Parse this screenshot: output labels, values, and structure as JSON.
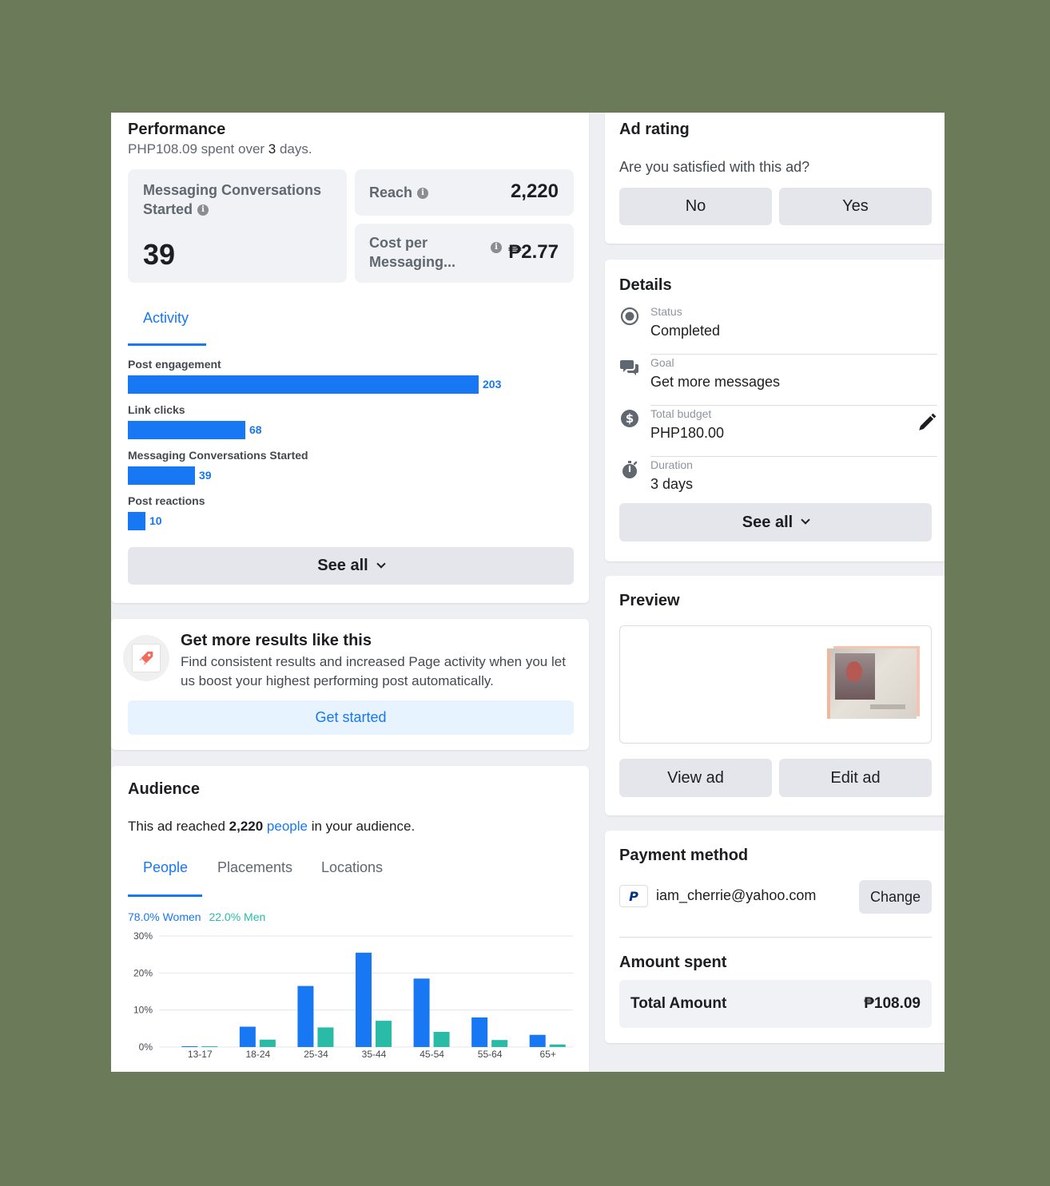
{
  "performance": {
    "title": "Performance",
    "spent_amount": "PHP108.09",
    "spent_mid": " spent over ",
    "spent_days": "3",
    "spent_end": " days.",
    "metrics": {
      "messaging_label": "Messaging Conversations Started",
      "messaging_value": "39",
      "reach_label": "Reach",
      "reach_value": "2,220",
      "cost_label": "Cost per Messaging...",
      "cost_value": "₱2.77"
    },
    "activity_tab": "Activity",
    "activity": [
      {
        "label": "Post engagement",
        "value": 203
      },
      {
        "label": "Link clicks",
        "value": 68
      },
      {
        "label": "Messaging Conversations Started",
        "value": 39
      },
      {
        "label": "Post reactions",
        "value": 10
      }
    ],
    "see_all": "See all"
  },
  "boost": {
    "title": "Get more results like this",
    "description": "Find consistent results and increased Page activity when you let us boost your highest performing post automatically.",
    "button": "Get started"
  },
  "audience": {
    "title": "Audience",
    "reach_prefix": "This ad reached ",
    "reach_count": "2,220",
    "reach_link": "people",
    "reach_suffix": " in your audience.",
    "tabs": [
      "People",
      "Placements",
      "Locations"
    ],
    "women_legend": "78.0% Women",
    "men_legend": "22.0% Men"
  },
  "chart_data": {
    "type": "bar",
    "categories": [
      "13-17",
      "18-24",
      "25-34",
      "35-44",
      "45-54",
      "55-64",
      "65+"
    ],
    "series": [
      {
        "name": "Women",
        "values": [
          0.2,
          5.5,
          16.5,
          25.5,
          18.5,
          8.0,
          3.3
        ],
        "color": "#1877f2"
      },
      {
        "name": "Men",
        "values": [
          0.1,
          2.0,
          5.3,
          7.1,
          4.1,
          1.9,
          0.7
        ],
        "color": "#2abba7"
      }
    ],
    "yticks": [
      "0%",
      "10%",
      "20%",
      "30%"
    ],
    "ylim": [
      0,
      30
    ],
    "grid": true
  },
  "ad_rating": {
    "title": "Ad rating",
    "question": "Are you satisfied with this ad?",
    "no": "No",
    "yes": "Yes"
  },
  "details": {
    "title": "Details",
    "rows": [
      {
        "label": "Status",
        "value": "Completed",
        "icon": "radio-icon"
      },
      {
        "label": "Goal",
        "value": "Get more messages",
        "icon": "chat-icon"
      },
      {
        "label": "Total budget",
        "value": "PHP180.00",
        "icon": "dollar-icon"
      },
      {
        "label": "Duration",
        "value": "3 days",
        "icon": "stopwatch-icon"
      }
    ],
    "see_all": "See all"
  },
  "preview": {
    "title": "Preview",
    "view_ad": "View ad",
    "edit_ad": "Edit ad"
  },
  "payment": {
    "title": "Payment method",
    "email": "iam_cherrie@yahoo.com",
    "change": "Change",
    "amount_title": "Amount spent",
    "total_label": "Total Amount",
    "total_value": "₱108.09"
  },
  "colors": {
    "accent": "#1877f2",
    "men": "#2abba7",
    "background": "#6b7a59"
  }
}
